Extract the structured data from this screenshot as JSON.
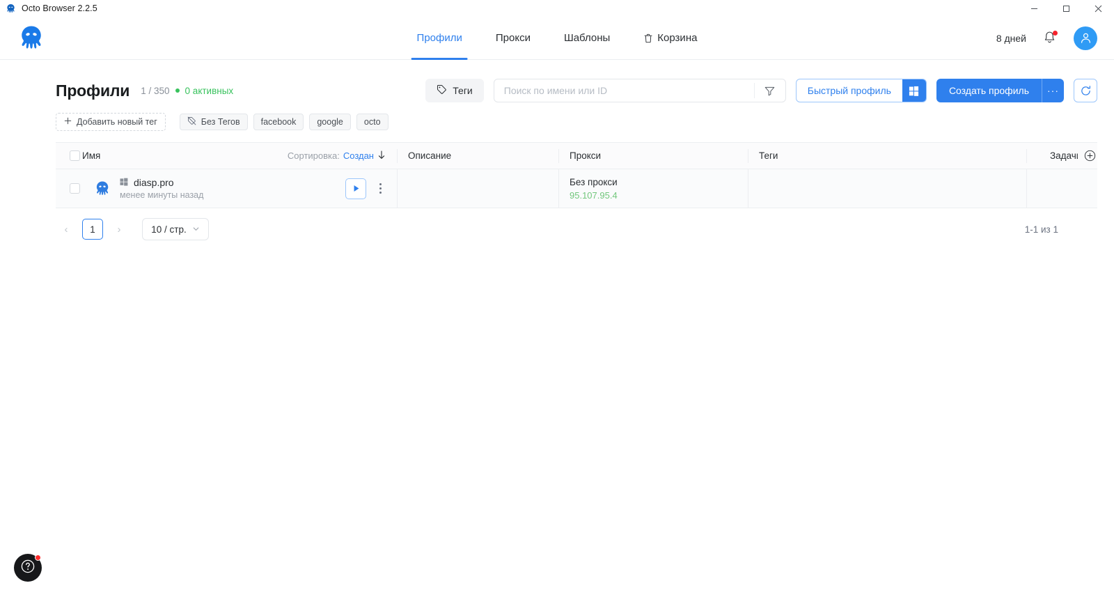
{
  "titlebar": {
    "app_title": "Octo Browser 2.2.5",
    "minimize": "minimize-icon",
    "maximize": "maximize-icon",
    "close": "close-icon"
  },
  "header": {
    "brand": "octo-logo",
    "nav": [
      {
        "label": "Профили",
        "icon": "",
        "active": true
      },
      {
        "label": "Прокси",
        "icon": "",
        "active": false
      },
      {
        "label": "Шаблоны",
        "icon": "",
        "active": false
      },
      {
        "label": "Корзина",
        "icon": "trash-icon",
        "active": false
      }
    ],
    "days_left": "8 дней",
    "notifications_icon": "bell-icon",
    "account_icon": "user-avatar-icon"
  },
  "toolbar": {
    "page_title": "Профили",
    "count": "1 / 350",
    "active_count": "0 активных",
    "tags_button": "Теги",
    "search_placeholder": "Поиск по имени или ID",
    "search_value": "",
    "filter_icon": "filter-icon",
    "quick_profile": "Быстрый профиль",
    "quick_profile_os_icon": "windows-icon",
    "create_profile": "Создать профиль",
    "create_more": "···",
    "refresh_icon": "refresh-icon"
  },
  "tags": {
    "add_label": "Добавить новый тег",
    "chips": [
      {
        "label": "Без Тегов",
        "icon": "tag-off-icon"
      },
      {
        "label": "facebook",
        "icon": ""
      },
      {
        "label": "google",
        "icon": ""
      },
      {
        "label": "octo",
        "icon": ""
      }
    ]
  },
  "table": {
    "columns": {
      "name": "Имя",
      "description": "Описание",
      "proxy": "Прокси",
      "tags": "Теги",
      "tasks": "Задачи"
    },
    "sort_label": "Сортировка:",
    "sort_value": "Создан",
    "sort_direction_icon": "arrow-down-icon",
    "add_task_icon": "plus-circle-icon",
    "rows": [
      {
        "name": "diasp.pro",
        "os_icon": "windows-icon",
        "subtitle": "менее минуты назад",
        "description": "",
        "proxy_main": "Без прокси",
        "proxy_ip": "95.107.95.4",
        "tags": "",
        "tasks": "",
        "run_icon": "play-icon",
        "menu_icon": "kebab-menu-icon"
      }
    ]
  },
  "pagination": {
    "prev": "‹",
    "next": "›",
    "current_page": "1",
    "page_size": "10 / стр.",
    "total_label": "1-1 из 1"
  },
  "help": {
    "icon": "question-mark-icon"
  },
  "colors": {
    "accent": "#2f80ed",
    "accent_light": "#2f9bf5",
    "success": "#38c25d",
    "proxy_ip": "#72c77c",
    "danger": "#f5222d",
    "row_bg": "#fafbfc",
    "header_bg": "#fbfbfc",
    "border": "#eceef1"
  }
}
